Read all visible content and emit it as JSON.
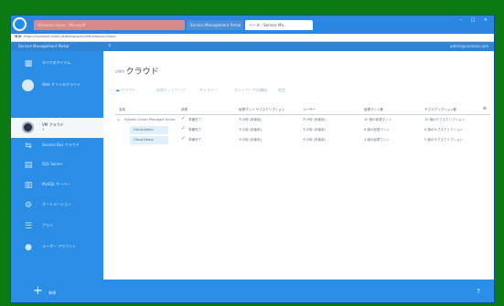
{
  "browser": {
    "tabs": [
      "Windows Azure - Microsoft",
      "Service Management Portal",
      "ベータ - Service Ma..."
    ],
    "tab_close": "×",
    "window_buttons": "– □ ×",
    "address": "https://localhost:30081/#Workspaces/VMExtension/Cloud",
    "nav_glyph": "◀ ▶"
  },
  "app": {
    "title": "Service Management Portal",
    "separator": "∨",
    "account": "admin@contoso.com"
  },
  "sidebar": {
    "items": [
      {
        "label": "すべてのアイテム",
        "icon": "grid-icon",
        "active": false
      },
      {
        "label": "Web サイトのクラウド",
        "icon": "globe-icon",
        "active": false
      },
      {
        "label": "VM クラウド",
        "sub": "3",
        "icon": "cloud-circle-icon",
        "active": true
      },
      {
        "label": "Service Bus クラウド",
        "icon": "bus-icon",
        "active": false
      },
      {
        "label": "SQL Server",
        "icon": "database-icon",
        "active": false
      },
      {
        "label": "MySQL サーバー",
        "icon": "mysql-icon",
        "active": false
      },
      {
        "label": "オートメーション",
        "icon": "automation-icon",
        "active": false
      },
      {
        "label": "プラン",
        "icon": "list-icon",
        "active": false
      },
      {
        "label": "ユーザー アカウント",
        "icon": "user-icon",
        "active": false
      }
    ]
  },
  "main": {
    "title_prefix": "VMM",
    "title": "クラウド",
    "toolbar": [
      {
        "label": "クラウド",
        "icon": "cloud-icon",
        "active": false
      },
      {
        "label": "仮想ネットワーク",
        "active": true
      },
      {
        "label": "ギャラリー",
        "active": false
      },
      {
        "label": "ネットワークの構成",
        "active": false
      },
      {
        "label": "設定",
        "active": false
      }
    ],
    "table": {
      "columns": [
        "名前",
        "状態",
        "仮想マシン サブスクリプション",
        "ユーザー",
        "仮想マシン数",
        "サブスクリプション数"
      ],
      "col_toggle": "⊕",
      "rows": [
        {
          "name": "System Center Managed Server",
          "status": "準備完了",
          "values": [
            "その他 (未使用)",
            "その他 (未使用)",
            "10 個の仮想マシン",
            "10 個のサブスクリプション"
          ],
          "expander": "∨"
        },
        {
          "name": "Cloud Demo",
          "status": "準備完了",
          "values": [
            "その他 (未使用)",
            "その他 (未使用)",
            "6 個の仮想マシン",
            "8 個のサブスクリプション"
          ]
        },
        {
          "name": "Cloud Demo",
          "status": "準備完了",
          "values": [
            "その他 (未使用)",
            "その他 (未使用)",
            "4 個の仮想マシン",
            "2 個のサブスクリプション"
          ]
        }
      ]
    }
  },
  "footer": {
    "new_label": "新規",
    "new_glyph": "+",
    "right_glyph": "?"
  },
  "colors": {
    "outer": "#0b7a12",
    "sidebar": "#2a8ee6",
    "status_ok": "#4cae2e"
  }
}
